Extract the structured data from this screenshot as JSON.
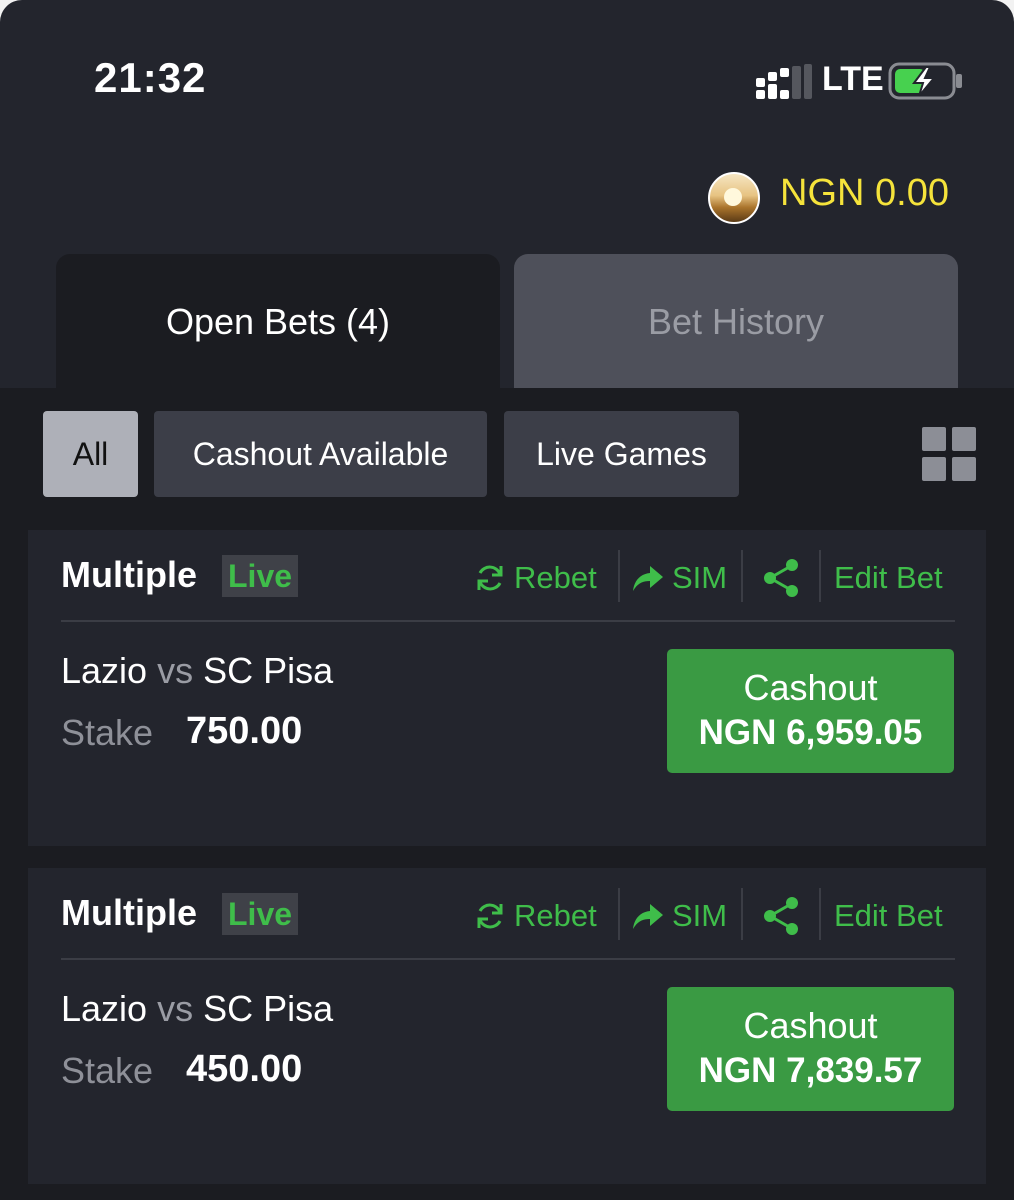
{
  "status_bar": {
    "time": "21:32",
    "network": "LTE",
    "signal_icon": "signal-icon",
    "battery_icon": "battery-charging-icon"
  },
  "header": {
    "balance": "NGN 0.00"
  },
  "tabs": [
    {
      "label": "Open Bets (4)",
      "active": true
    },
    {
      "label": "Bet History",
      "active": false
    }
  ],
  "filters": [
    {
      "label": "All",
      "active": true
    },
    {
      "label": "Cashout Available",
      "active": false
    },
    {
      "label": "Live Games",
      "active": false
    }
  ],
  "actions": {
    "rebet": "Rebet",
    "sim": "SIM",
    "edit": "Edit Bet"
  },
  "bets": [
    {
      "type": "Multiple",
      "badge": "Live",
      "home": "Lazio",
      "vs": "vs",
      "away": "SC Pisa",
      "stake_label": "Stake",
      "stake": "750.00",
      "cashout_label": "Cashout",
      "cashout_value": "NGN 6,959.05"
    },
    {
      "type": "Multiple",
      "badge": "Live",
      "home": "Lazio",
      "vs": "vs",
      "away": "SC Pisa",
      "stake_label": "Stake",
      "stake": "450.00",
      "cashout_label": "Cashout",
      "cashout_value": "NGN 7,839.57"
    }
  ],
  "colors": {
    "accent_green": "#3fbd4a",
    "button_green": "#3a9a43",
    "balance_yellow": "#f5e33b",
    "background": "#1b1c21"
  }
}
